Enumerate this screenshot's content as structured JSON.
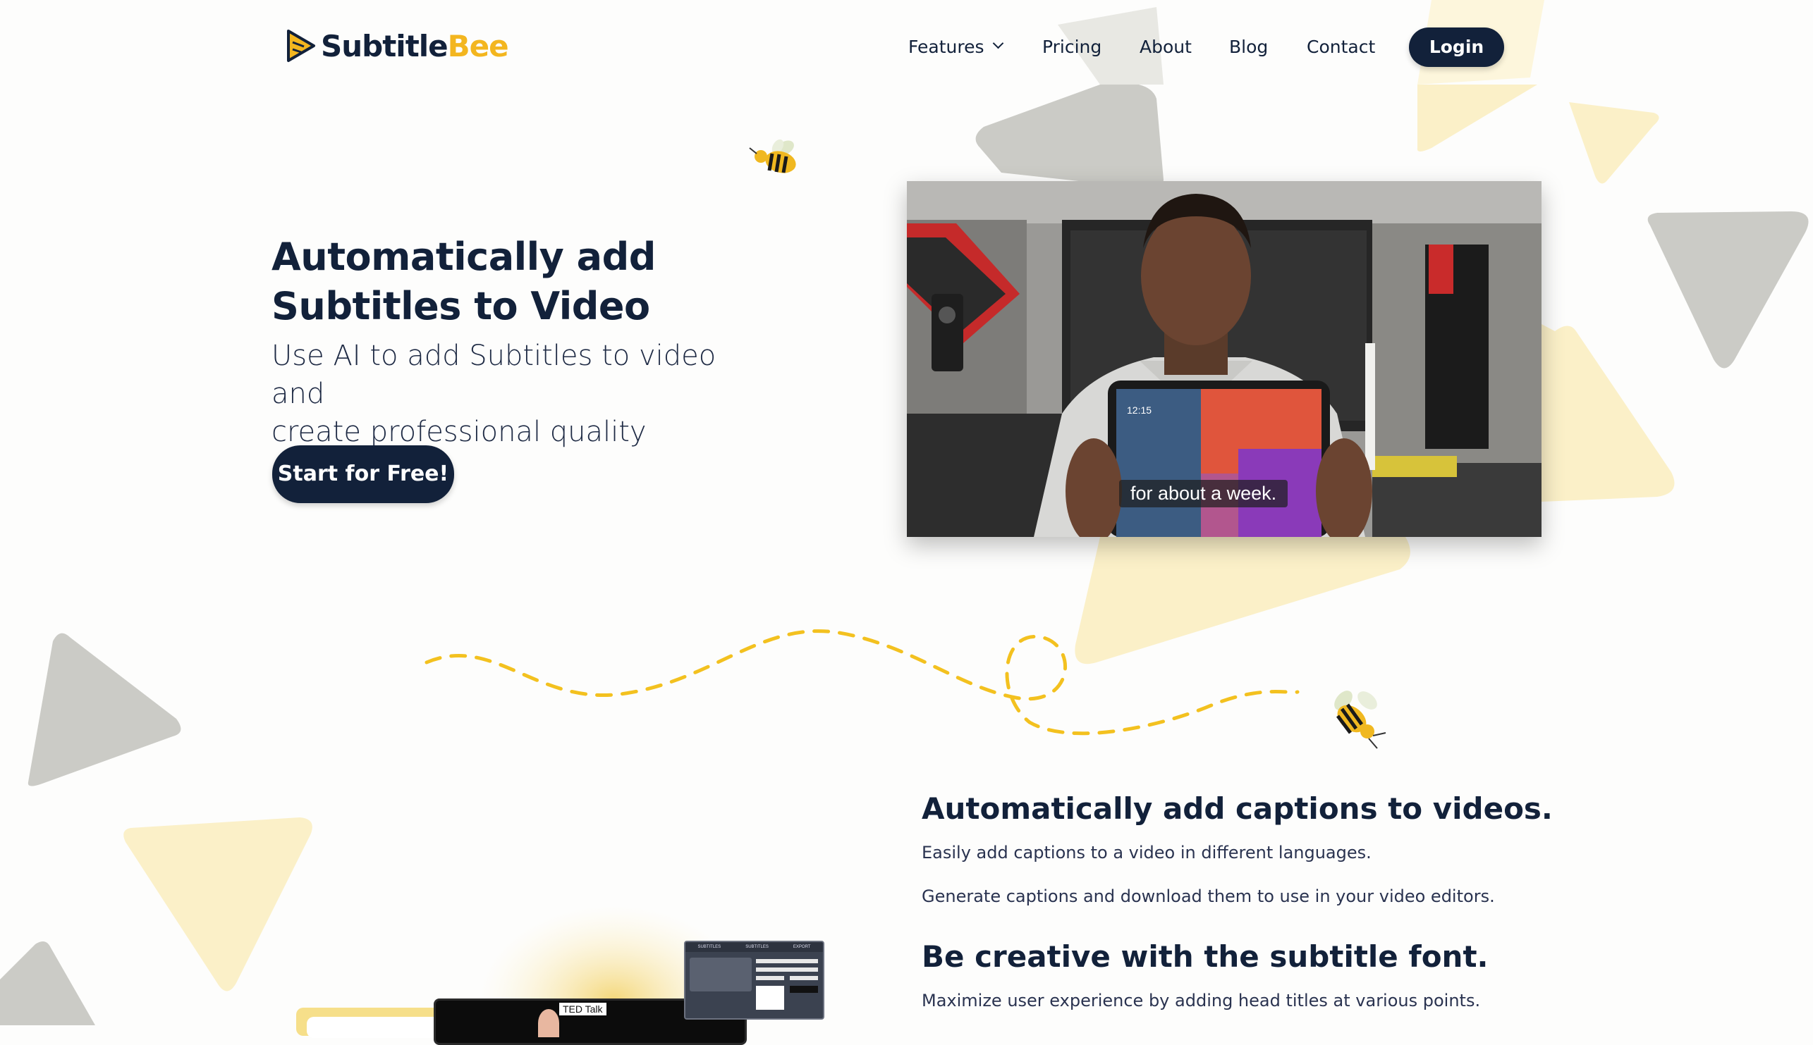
{
  "brand": {
    "name_part1": "Subtitle",
    "name_part2": "Bee",
    "accent": "#f3b61f",
    "navy": "#12213a"
  },
  "nav": {
    "features": "Features",
    "pricing": "Pricing",
    "about": "About",
    "blog": "Blog",
    "contact": "Contact",
    "login": "Login"
  },
  "hero": {
    "title_line1": "Automatically add",
    "title_line2": "Subtitles to Video",
    "subtitle_line1": "Use AI to add Subtitles to video and",
    "subtitle_line2": "create professional quality content.",
    "cta": "Start for Free!"
  },
  "video": {
    "caption": "for about a week.",
    "tablet_time": "12:15"
  },
  "features": {
    "f1_title": "Automatically add captions to videos.",
    "f1_text1": "Easily add captions to a video in different languages.",
    "f1_text2": "Generate captions and download them to use in your video editors.",
    "f2_title": "Be creative with the subtitle font.",
    "f2_text1": "Maximize user experience by adding head titles at various points."
  },
  "preview": {
    "ted_label": "TED Talk",
    "tab1": "SUBTITLES",
    "tab2": "SUBTITLES",
    "tab3": "EXPORT"
  },
  "icons": [
    "logo-play-icon",
    "bee-icon",
    "chevron-down-icon"
  ]
}
